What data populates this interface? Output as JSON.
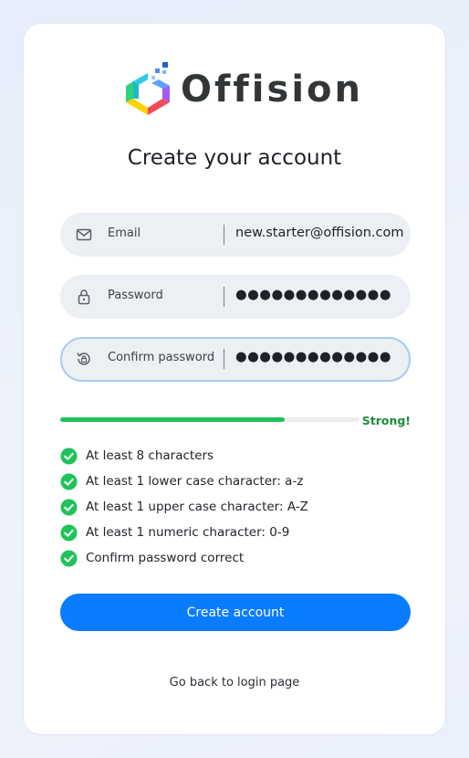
{
  "brand": {
    "name": "Offision"
  },
  "page": {
    "title": "Create your account"
  },
  "form": {
    "email": {
      "label": "Email",
      "value": "new.starter@offision.com"
    },
    "password": {
      "label": "Password",
      "value": "●●●●●●●●●●●●●"
    },
    "confirm": {
      "label": "Confirm password",
      "value": "●●●●●●●●●●●●●"
    }
  },
  "strength": {
    "label": "Strong!",
    "fraction": 0.75,
    "color": "#1fc35a"
  },
  "requirements": [
    "At least 8 characters",
    "At least 1 lower case character: a-z",
    "At least 1 upper case character: A-Z",
    "At least 1 numeric character: 0-9",
    "Confirm password correct"
  ],
  "actions": {
    "create": "Create account",
    "back": "Go back to login page"
  },
  "colors": {
    "accent": "#0a7cff",
    "success": "#1fc35a",
    "field_bg": "#eceff3"
  }
}
